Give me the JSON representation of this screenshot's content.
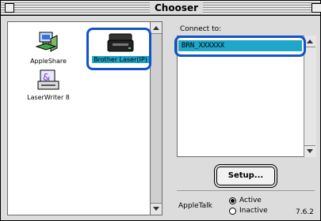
{
  "window": {
    "title": "Chooser"
  },
  "devices": [
    {
      "label": "AppleShare",
      "icon": "appleshare-icon",
      "selected": false
    },
    {
      "label": "Brother Laser(IP)",
      "icon": "printer-icon",
      "selected": true
    },
    {
      "label": "LaserWriter 8",
      "icon": "laserwriter-icon",
      "selected": false
    }
  ],
  "connect": {
    "label": "Connect to:",
    "items": [
      "BRN_XXXXXX"
    ]
  },
  "setup_button": {
    "label": "Setup..."
  },
  "appletalk": {
    "label": "AppleTalk",
    "options": [
      {
        "label": "Active",
        "selected": true
      },
      {
        "label": "Inactive",
        "selected": false
      }
    ]
  },
  "version": "7.6.2",
  "colors": {
    "selection": "#1fa6c9",
    "highlight_ring": "#1254c8",
    "window_bg": "#dcdcdc"
  }
}
